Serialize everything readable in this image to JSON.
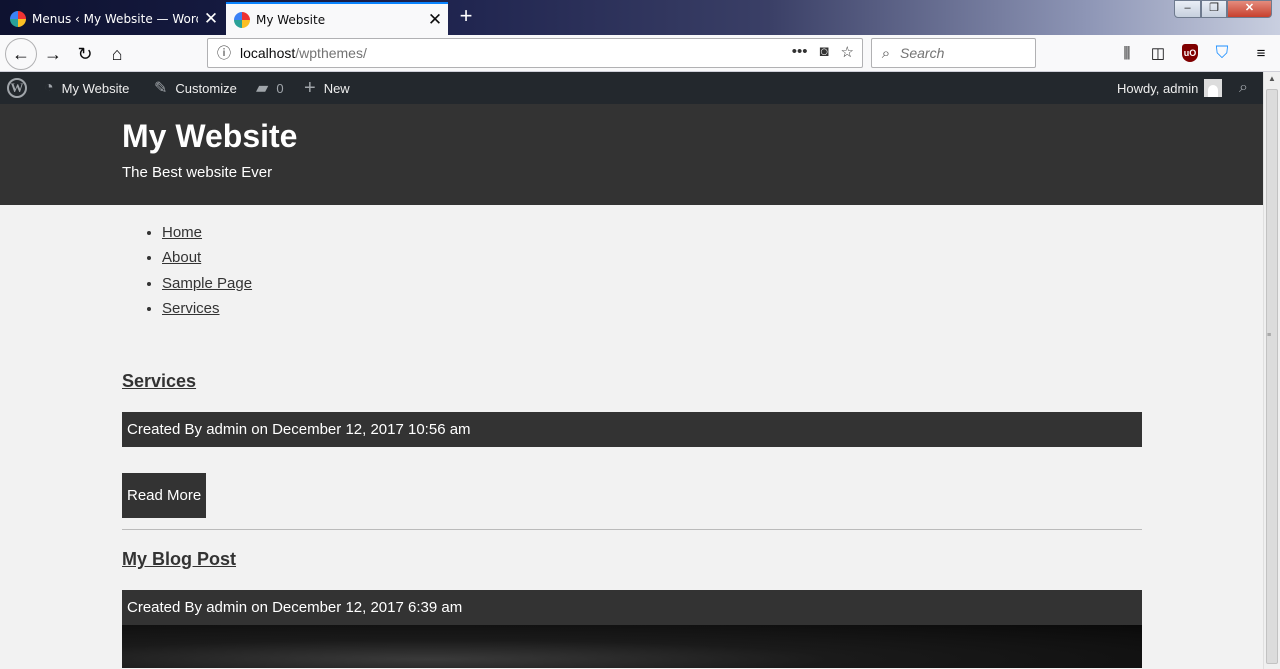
{
  "browser": {
    "tabs": [
      {
        "title": "Menus ‹ My Website — WordPr",
        "active": false
      },
      {
        "title": "My Website",
        "active": true
      }
    ],
    "url": {
      "host": "localhost",
      "path": "/wpthemes/"
    },
    "search_placeholder": "Search"
  },
  "adminbar": {
    "site_name": "My Website",
    "customize": "Customize",
    "comments_count": "0",
    "new_label": "New",
    "howdy": "Howdy, admin"
  },
  "site": {
    "title": "My Website",
    "description": "The Best website Ever"
  },
  "menu": [
    "Home",
    "About",
    "Sample Page",
    "Services"
  ],
  "posts": [
    {
      "title": "Services",
      "meta": "Created By admin on December 12, 2017 10:56 am",
      "read_more": "Read More"
    },
    {
      "title": "My Blog Post",
      "meta": "Created By admin on December 12, 2017 6:39 am"
    }
  ]
}
